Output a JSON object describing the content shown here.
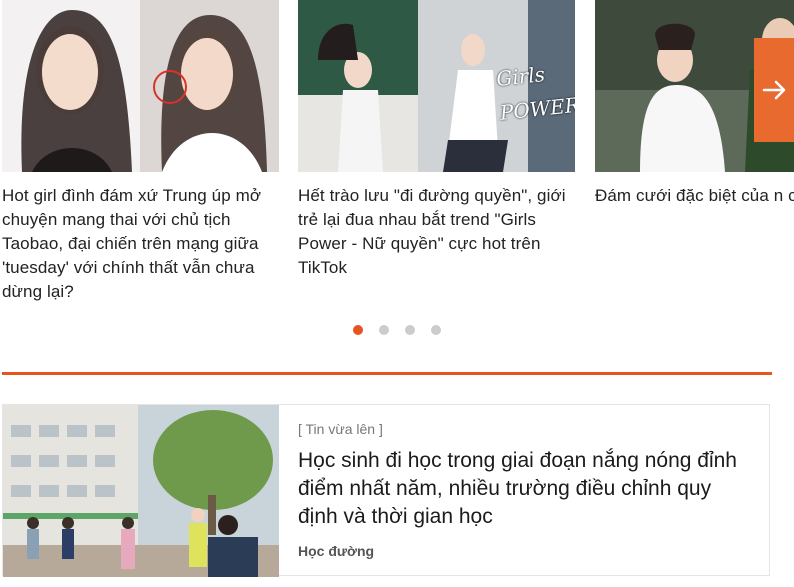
{
  "carousel": {
    "items": [
      {
        "title": "Hot girl đình đám xứ Trung úp mở chuyện mang thai với chủ tịch Taobao, đại chiến trên mạng giữa 'tuesday' với chính thất vẫn chưa dừng lại?"
      },
      {
        "title": "Hết trào lưu \"đi đường quyền\", giới trẻ lại đua nhau bắt trend \"Girls Power - Nữ quyền\" cực hot trên TikTok",
        "overlay_text": "Girls POWER"
      },
      {
        "title": "Đám cưới đặc biệt của n chiến sĩ biên phòng và c mầm non sau khi phải h chú rể nhận nhiệm vụ tạ đầu chống dịch Covid-19"
      }
    ],
    "next_icon": "arrow-right-icon",
    "dots": [
      true,
      false,
      false,
      false
    ]
  },
  "colors": {
    "accent": "#e8541f",
    "next_button": "#e86a2f"
  },
  "news": {
    "tag": "[ Tin vừa lên ]",
    "headline": "Học sinh đi học trong giai đoạn nắng nóng đỉnh điểm nhất năm, nhiều trường điều chỉnh quy định và thời gian học",
    "category": "Học đường"
  }
}
